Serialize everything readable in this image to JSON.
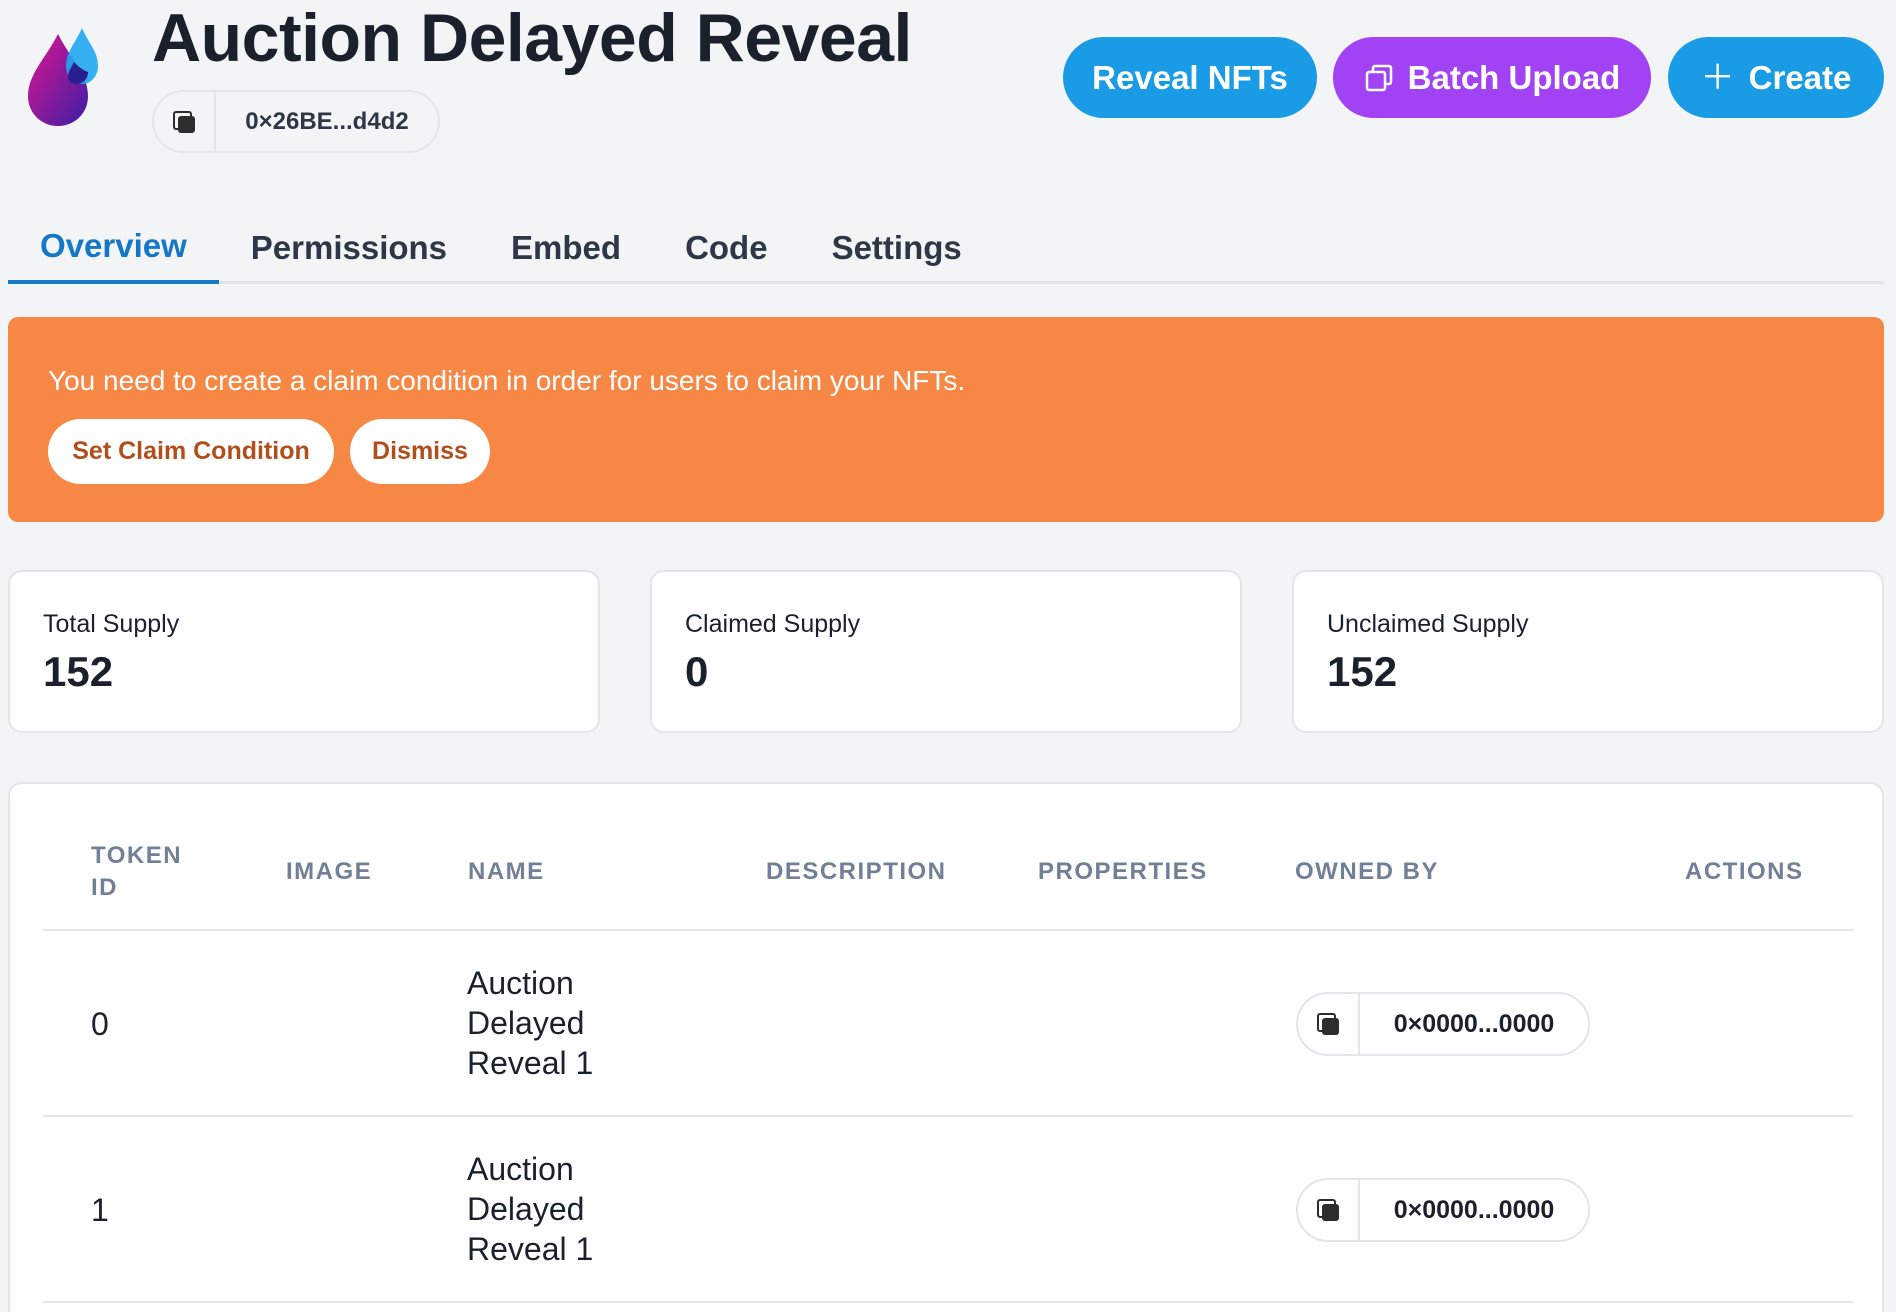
{
  "header": {
    "title": "Auction Delayed Reveal",
    "address": "0×26BE...d4d2"
  },
  "actions": {
    "reveal_label": "Reveal NFTs",
    "batch_label": "Batch Upload",
    "create_label": "Create"
  },
  "tabs": [
    {
      "label": "Overview"
    },
    {
      "label": "Permissions"
    },
    {
      "label": "Embed"
    },
    {
      "label": "Code"
    },
    {
      "label": "Settings"
    }
  ],
  "banner": {
    "message": "You need to create a claim condition in order for users to claim your NFTs.",
    "set_label": "Set Claim Condition",
    "dismiss_label": "Dismiss"
  },
  "stats": [
    {
      "label": "Total Supply",
      "value": "152"
    },
    {
      "label": "Claimed Supply",
      "value": "0"
    },
    {
      "label": "Unclaimed Supply",
      "value": "152"
    }
  ],
  "table": {
    "columns": {
      "token_id": "TOKEN ID",
      "image": "IMAGE",
      "name": "NAME",
      "description": "DESCRIPTION",
      "properties": "PROPERTIES",
      "owned_by": "OWNED BY",
      "actions": "ACTIONS"
    },
    "rows": [
      {
        "token_id": "0",
        "name": "Auction Delayed Reveal 1",
        "owner": "0×0000...0000"
      },
      {
        "token_id": "1",
        "name": "Auction Delayed Reveal 1",
        "owner": "0×0000...0000"
      }
    ]
  },
  "colors": {
    "accent_blue": "#1a9be6",
    "accent_purple": "#a142f4",
    "banner_orange": "#f78745",
    "tab_active": "#1477c7"
  }
}
